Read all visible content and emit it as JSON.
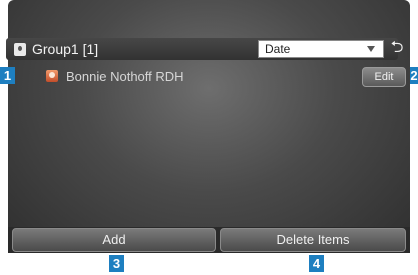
{
  "header": {
    "title": "Group1 [1]",
    "sort": {
      "selected": "Date"
    },
    "back_glyph": "⮌"
  },
  "list": {
    "items": [
      {
        "name": "Bonnie Nothoff RDH",
        "edit_label": "Edit"
      }
    ]
  },
  "toolbar": {
    "add_label": "Add",
    "delete_label": "Delete Items"
  },
  "callouts": {
    "c1": "1",
    "c2": "2",
    "c3": "3",
    "c4": "4"
  },
  "icons": {
    "group": "pin-icon",
    "contact": "contact-icon",
    "back": "back-icon",
    "dropdown": "chevron-down-icon"
  },
  "colors": {
    "callout": "#1e7fc0",
    "contact_icon": "#d9643a"
  }
}
